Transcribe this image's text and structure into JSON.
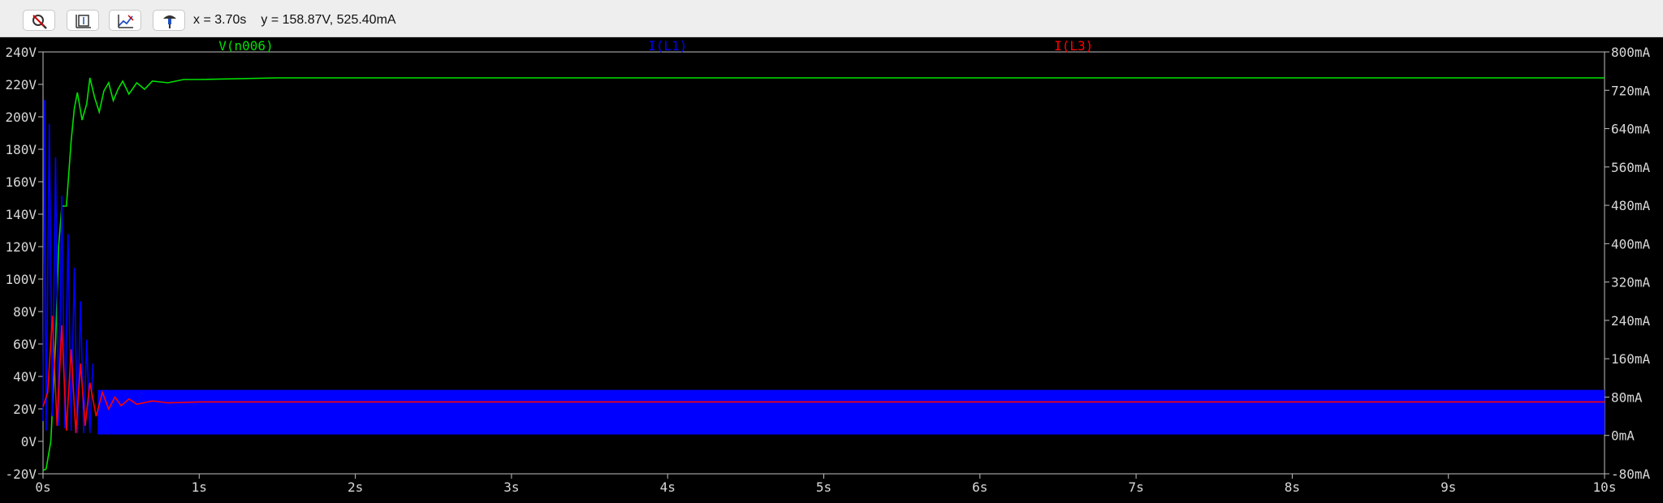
{
  "toolbar": {
    "buttons": [
      {
        "name": "zoom-cancel-icon"
      },
      {
        "name": "autorange-icon"
      },
      {
        "name": "mark-data-icon"
      },
      {
        "name": "probe-icon"
      }
    ],
    "readout_x": "x = 3.70s",
    "readout_y": "y = 158.87V, 525.40mA"
  },
  "colors": {
    "background": "#000000",
    "axis": "#bfbfbf",
    "tick_text": "#d8d8d8",
    "v_n006": "#00e000",
    "i_l1": "#0000ff",
    "i_l3": "#ff0000"
  },
  "chart_data": {
    "type": "line",
    "x_ticks": [
      "0s",
      "1s",
      "2s",
      "3s",
      "4s",
      "5s",
      "6s",
      "7s",
      "8s",
      "9s",
      "10s"
    ],
    "xlim": [
      0,
      10
    ],
    "y_left": {
      "unit": "V",
      "ylim": [
        -20,
        240
      ],
      "ticks": [
        "-20V",
        "0V",
        "20V",
        "40V",
        "60V",
        "80V",
        "100V",
        "120V",
        "140V",
        "160V",
        "180V",
        "200V",
        "220V",
        "240V"
      ]
    },
    "y_right": {
      "unit": "mA",
      "ylim": [
        -80,
        800
      ],
      "ticks": [
        "-80mA",
        "0mA",
        "80mA",
        "160mA",
        "240mA",
        "320mA",
        "400mA",
        "480mA",
        "560mA",
        "640mA",
        "720mA",
        "800mA"
      ]
    },
    "series": [
      {
        "name": "V(n006)",
        "axis": "left",
        "points": [
          [
            0,
            -18
          ],
          [
            0.02,
            -17
          ],
          [
            0.05,
            0
          ],
          [
            0.08,
            60
          ],
          [
            0.1,
            120
          ],
          [
            0.12,
            145
          ],
          [
            0.15,
            145
          ],
          [
            0.18,
            185
          ],
          [
            0.2,
            205
          ],
          [
            0.22,
            215
          ],
          [
            0.25,
            198
          ],
          [
            0.28,
            208
          ],
          [
            0.3,
            224
          ],
          [
            0.33,
            212
          ],
          [
            0.36,
            203
          ],
          [
            0.39,
            216
          ],
          [
            0.42,
            221
          ],
          [
            0.45,
            210
          ],
          [
            0.48,
            217
          ],
          [
            0.51,
            222
          ],
          [
            0.55,
            214
          ],
          [
            0.6,
            221
          ],
          [
            0.65,
            217
          ],
          [
            0.7,
            222
          ],
          [
            0.8,
            221
          ],
          [
            0.9,
            223
          ],
          [
            1.0,
            223
          ],
          [
            1.5,
            224
          ],
          [
            3.0,
            224
          ],
          [
            6.0,
            224
          ],
          [
            10,
            224
          ]
        ]
      },
      {
        "name": "I(L1)",
        "axis": "right",
        "band": {
          "from": 0.35,
          "to": 10,
          "low": 2,
          "high": 95
        },
        "points": [
          [
            0,
            30
          ],
          [
            0.01,
            700
          ],
          [
            0.02,
            10
          ],
          [
            0.04,
            650
          ],
          [
            0.06,
            40
          ],
          [
            0.08,
            580
          ],
          [
            0.1,
            20
          ],
          [
            0.12,
            500
          ],
          [
            0.14,
            15
          ],
          [
            0.16,
            420
          ],
          [
            0.18,
            10
          ],
          [
            0.2,
            350
          ],
          [
            0.22,
            5
          ],
          [
            0.24,
            280
          ],
          [
            0.26,
            5
          ],
          [
            0.28,
            200
          ],
          [
            0.3,
            5
          ],
          [
            0.32,
            150
          ]
        ]
      },
      {
        "name": "I(L3)",
        "axis": "right",
        "points": [
          [
            0,
            60
          ],
          [
            0.03,
            90
          ],
          [
            0.06,
            250
          ],
          [
            0.09,
            20
          ],
          [
            0.12,
            230
          ],
          [
            0.15,
            10
          ],
          [
            0.18,
            180
          ],
          [
            0.21,
            5
          ],
          [
            0.24,
            150
          ],
          [
            0.27,
            20
          ],
          [
            0.3,
            110
          ],
          [
            0.34,
            40
          ],
          [
            0.38,
            90
          ],
          [
            0.42,
            55
          ],
          [
            0.46,
            80
          ],
          [
            0.5,
            62
          ],
          [
            0.55,
            76
          ],
          [
            0.6,
            65
          ],
          [
            0.7,
            72
          ],
          [
            0.8,
            68
          ],
          [
            1.0,
            70
          ],
          [
            3,
            70
          ],
          [
            6,
            70
          ],
          [
            10,
            70
          ]
        ]
      }
    ]
  }
}
